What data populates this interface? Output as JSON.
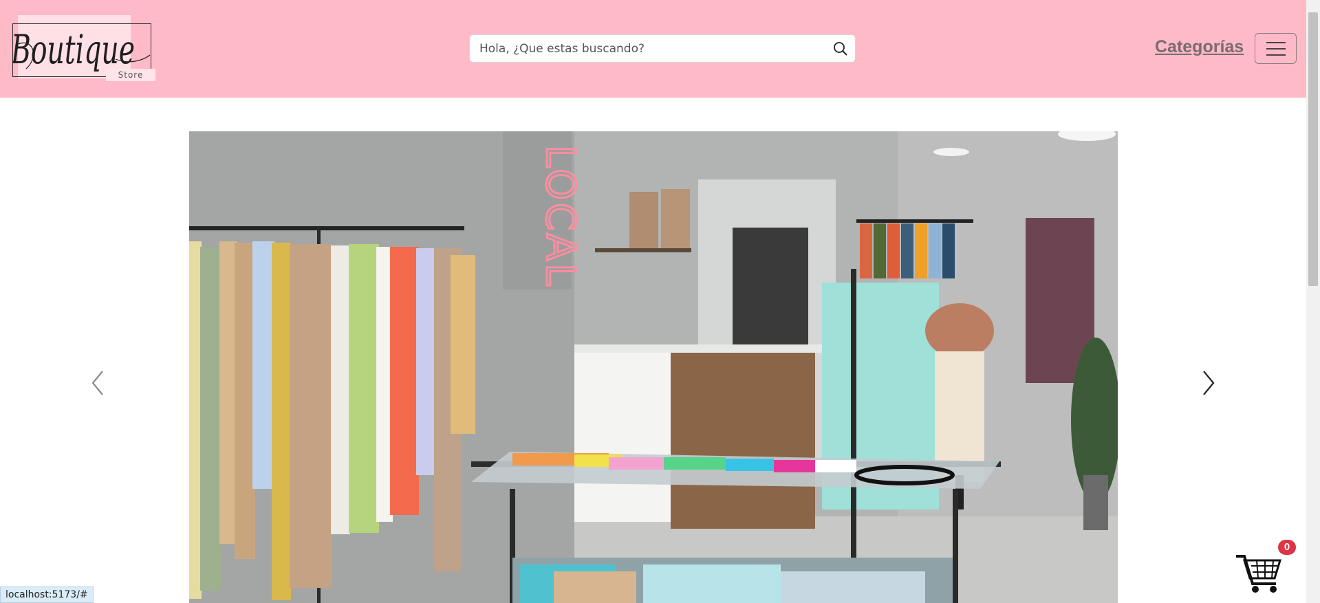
{
  "header": {
    "logo_script": "Boutique",
    "logo_sub": "Store",
    "search_placeholder": "Hola, ¿Que estas buscando?",
    "categories_label": "Categorías"
  },
  "carousel": {
    "sign_text": "LOCAL",
    "prev_icon": "chevron-left-icon",
    "next_icon": "chevron-right-icon"
  },
  "cart": {
    "count": "0"
  },
  "status_bar": {
    "url": "localhost:5173/#"
  },
  "colors": {
    "header_bg": "#ffbac8",
    "categories_text": "#7a6b6e",
    "badge": "#dc3545"
  }
}
